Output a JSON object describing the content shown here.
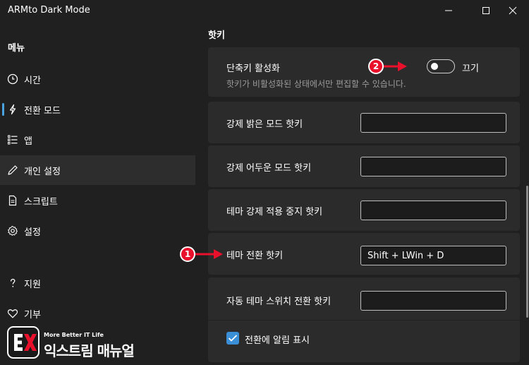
{
  "window": {
    "title": "ARMto Dark Mode"
  },
  "sidebar": {
    "title": "메뉴",
    "items": [
      {
        "label": "시간",
        "icon": "clock-icon"
      },
      {
        "label": "전환 모드",
        "icon": "lightning-icon"
      },
      {
        "label": "앱",
        "icon": "list-icon"
      },
      {
        "label": "개인 설정",
        "icon": "pencil-icon"
      },
      {
        "label": "스크립트",
        "icon": "document-icon"
      },
      {
        "label": "설정",
        "icon": "gear-icon"
      },
      {
        "label": "지원",
        "icon": "question-icon"
      },
      {
        "label": "기부",
        "icon": "heart-icon"
      }
    ]
  },
  "main": {
    "section_title": "핫키",
    "shortcut_enable": {
      "label": "단축키 활성화",
      "description": "핫키가 비활성화된 상태에서만 편집할 수 있습니다.",
      "toggle_state": "끄기"
    },
    "hotkeys": [
      {
        "label": "강제 밝은 모드 핫키",
        "value": ""
      },
      {
        "label": "강제 어두운 모드 핫키",
        "value": ""
      },
      {
        "label": "테마 강제 적용 중지 핫키",
        "value": ""
      },
      {
        "label": "테마 전환 핫키",
        "value": "Shift + LWin + D"
      },
      {
        "label": "자동 테마 스위치 전환 핫키",
        "value": ""
      }
    ],
    "notification": {
      "label": "전환에 알림 표시",
      "checked": true
    }
  },
  "annotations": {
    "badge_1": "1",
    "badge_2": "2",
    "color": "#e8102a"
  },
  "logo": {
    "tagline": "More Better IT Life",
    "name": "익스트림 매뉴얼"
  },
  "colors": {
    "background": "#202020",
    "card": "#2b2b2b",
    "accent": "#3b8fd6",
    "active_nav": "#2d2d2d"
  }
}
